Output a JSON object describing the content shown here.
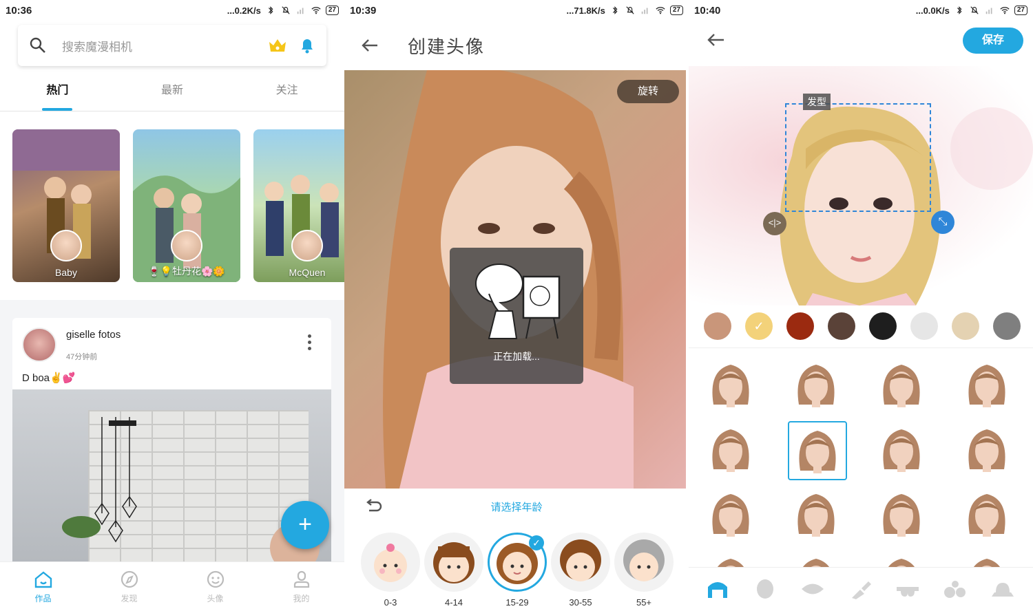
{
  "screen1": {
    "status": {
      "time": "10:36",
      "speed": "...0.2K/s",
      "battery": "27"
    },
    "search": {
      "placeholder": "搜索魔漫相机"
    },
    "tabs": [
      {
        "label": "热门"
      },
      {
        "label": "最新"
      },
      {
        "label": "关注"
      }
    ],
    "cards": [
      {
        "name": "Baby"
      },
      {
        "name": "🍷💡牡丹花🌸🌼"
      },
      {
        "name": "McQuen"
      }
    ],
    "post": {
      "username": "giselle fotos",
      "time": "47分钟前",
      "text": "D boa✌️💕"
    },
    "fab_label": "+",
    "bottom_nav": [
      {
        "label": "作品",
        "icon": "home-icon"
      },
      {
        "label": "发现",
        "icon": "compass-icon"
      },
      {
        "label": "头像",
        "icon": "smiley-icon"
      },
      {
        "label": "我的",
        "icon": "user-icon"
      }
    ],
    "colors": {
      "accent": "#23a8e0"
    }
  },
  "screen2": {
    "status": {
      "time": "10:39",
      "speed": "...71.8K/s",
      "battery": "27"
    },
    "title": "创建头像",
    "rotate_label": "旋转",
    "loading_text": "正在加载...",
    "age_hint": "请选择年龄",
    "ages": [
      {
        "label": "0-3",
        "selected": false
      },
      {
        "label": "4-14",
        "selected": false
      },
      {
        "label": "15-29",
        "selected": true
      },
      {
        "label": "30-55",
        "selected": false
      },
      {
        "label": "55+",
        "selected": false
      }
    ]
  },
  "screen3": {
    "status": {
      "time": "10:40",
      "speed": "...0.0K/s",
      "battery": "27"
    },
    "save_label": "保存",
    "selection_tag": "发型",
    "swatches": [
      "#c9967a",
      "#f3d27a",
      "#9b2a10",
      "#5a4238",
      "#1e1e1e",
      "#e6e6e6",
      "#e4d2b2",
      "#7f7f7f"
    ],
    "selected_swatch": 1,
    "selected_hair": 5,
    "categories": [
      {
        "icon": "hair-icon",
        "active": true
      },
      {
        "icon": "face-shape-icon",
        "active": false
      },
      {
        "icon": "eye-icon",
        "active": false
      },
      {
        "icon": "brush-icon",
        "active": false
      },
      {
        "icon": "glasses-icon",
        "active": false
      },
      {
        "icon": "accessory-icon",
        "active": false
      },
      {
        "icon": "hat-icon",
        "active": false
      }
    ]
  }
}
